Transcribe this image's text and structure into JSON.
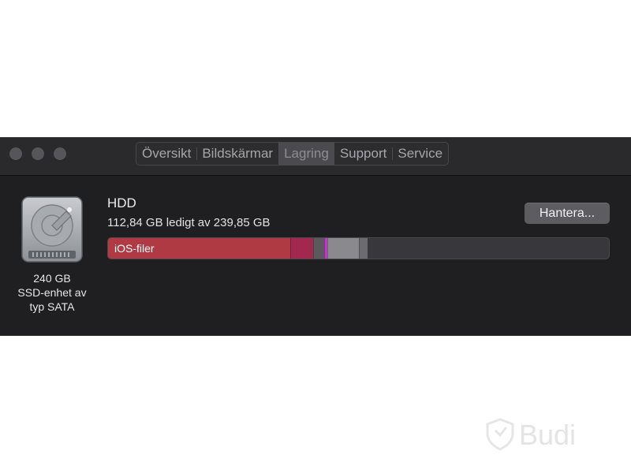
{
  "toolbar": {
    "tabs": [
      {
        "label": "Översikt"
      },
      {
        "label": "Bildskärmar"
      },
      {
        "label": "Lagring"
      },
      {
        "label": "Support"
      },
      {
        "label": "Service"
      }
    ],
    "active_tab": "Lagring"
  },
  "disk": {
    "icon": "hard-drive-icon",
    "caption_line1": "240 GB",
    "caption_line2": "SSD-enhet av",
    "caption_line3": "typ SATA"
  },
  "volume": {
    "name": "HDD",
    "free_text": "112,84 GB ledigt av 239,85 GB",
    "manage_label": "Hantera...",
    "free_gb": 112.84,
    "total_gb": 239.85,
    "bar_label": "iOS-filer",
    "segments": [
      {
        "name": "iOS-filer",
        "fraction": 0.364,
        "color": "#b03a44"
      },
      {
        "name": "segment-2",
        "fraction": 0.045,
        "color": "#a3284f"
      },
      {
        "name": "segment-3",
        "fraction": 0.022,
        "color": "#5a5a5e"
      },
      {
        "name": "segment-4",
        "fraction": 0.006,
        "color": "#c238c9"
      },
      {
        "name": "segment-5",
        "fraction": 0.063,
        "color": "#8a8a8e"
      },
      {
        "name": "segment-6",
        "fraction": 0.016,
        "color": "#6c6c70"
      }
    ],
    "free_color": "#38383c"
  },
  "watermark": {
    "text": "Budi"
  }
}
